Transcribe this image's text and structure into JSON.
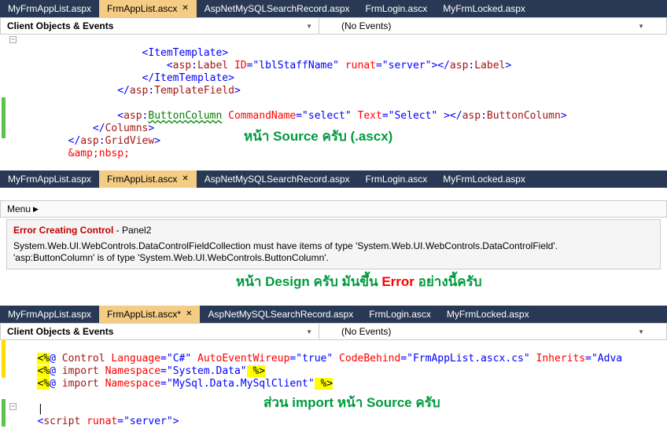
{
  "section1": {
    "tabs": [
      "MyFrmAppList.aspx",
      "FrmAppList.ascx",
      "AspNetMySQLSearchRecord.aspx",
      "FrmLogin.ascx",
      "MyFrmLocked.aspx"
    ],
    "active_index": 1,
    "dropdown_left": "Client Objects & Events",
    "dropdown_right": "(No Events)",
    "code": {
      "l1": "<ItemTemplate>",
      "l2a": "<",
      "l2b": "asp",
      "l2c": ":",
      "l2d": "Label",
      "l2e": " ID",
      "l2f": "=\"lblStaffName\"",
      "l2g": " runat",
      "l2h": "=\"server\"",
      "l2i": "></",
      "l2j": "asp",
      "l2k": ":",
      "l2l": "Label",
      "l2m": ">",
      "l3": "</ItemTemplate>",
      "l4a": "</",
      "l4b": "asp",
      "l4c": ":",
      "l4d": "TemplateField",
      "l4e": ">",
      "l5a": "<",
      "l5b": "asp",
      "l5c": ":",
      "l5d": "ButtonColumn",
      "l5e": " CommandName",
      "l5f": "=\"select\"",
      "l5g": " Text",
      "l5h": "=\"Select\"",
      "l5i": " ></",
      "l5j": "asp",
      "l5k": ":",
      "l5l": "ButtonColumn",
      "l5m": ">",
      "l6a": "</",
      "l6b": "Columns",
      "l6c": ">",
      "l7a": "</",
      "l7b": "asp",
      "l7c": ":",
      "l7d": "GridView",
      "l7e": ">",
      "l8a": "&amp;",
      "l8b": "nbsp;"
    },
    "annotation": "หน้า   Source ครับ (.ascx)"
  },
  "section2": {
    "tabs": [
      "MyFrmAppList.aspx",
      "FrmAppList.ascx",
      "AspNetMySQLSearchRecord.aspx",
      "FrmLogin.ascx",
      "MyFrmLocked.aspx"
    ],
    "active_index": 1,
    "menu_label": "Menu",
    "error_title": "Error Creating Control",
    "error_suffix": " - Panel2",
    "error_body1": "System.Web.UI.WebControls.DataControlFieldCollection must have items of type 'System.Web.UI.WebControls.DataControlField'.",
    "error_body2": "'asp:ButtonColumn' is of type 'System.Web.UI.WebControls.ButtonColumn'.",
    "annotation_a": "หน้า   Design ครับ   มันขึ้น   ",
    "annotation_b": "Error",
    "annotation_c": " อย่างนี้ครับ"
  },
  "section3": {
    "tabs": [
      "MyFrmAppList.aspx",
      "FrmAppList.ascx*",
      "AspNetMySQLSearchRecord.aspx",
      "FrmLogin.ascx",
      "MyFrmLocked.aspx"
    ],
    "active_index": 1,
    "dropdown_left": "Client Objects & Events",
    "dropdown_right": "(No Events)",
    "code": {
      "d1a": "<%",
      "d1b": "@",
      "d1c": " Control",
      "d1d": " Language",
      "d1e": "=\"C#\"",
      "d1f": " AutoEventWireup",
      "d1g": "=\"true\"",
      "d1h": " CodeBehind",
      "d1i": "=\"FrmAppList.ascx.cs\"",
      "d1j": " Inherits",
      "d1k": "=\"Adva",
      "d2a": "<%",
      "d2b": "@",
      "d2c": " import",
      "d2d": " Namespace",
      "d2e": "=\"System.Data\"",
      "d2f": " %>",
      "d3a": "<%",
      "d3b": "@",
      "d3c": " import",
      "d3d": " Namespace",
      "d3e": "=\"MySql.Data.MySqlClient\"",
      "d3f": " %>",
      "d4": "|",
      "d5a": "<",
      "d5b": "script",
      "d5c": " runat",
      "d5d": "=\"server\"",
      "d5e": ">"
    },
    "annotation": "ส่วน   import หน้า   Source ครับ"
  }
}
